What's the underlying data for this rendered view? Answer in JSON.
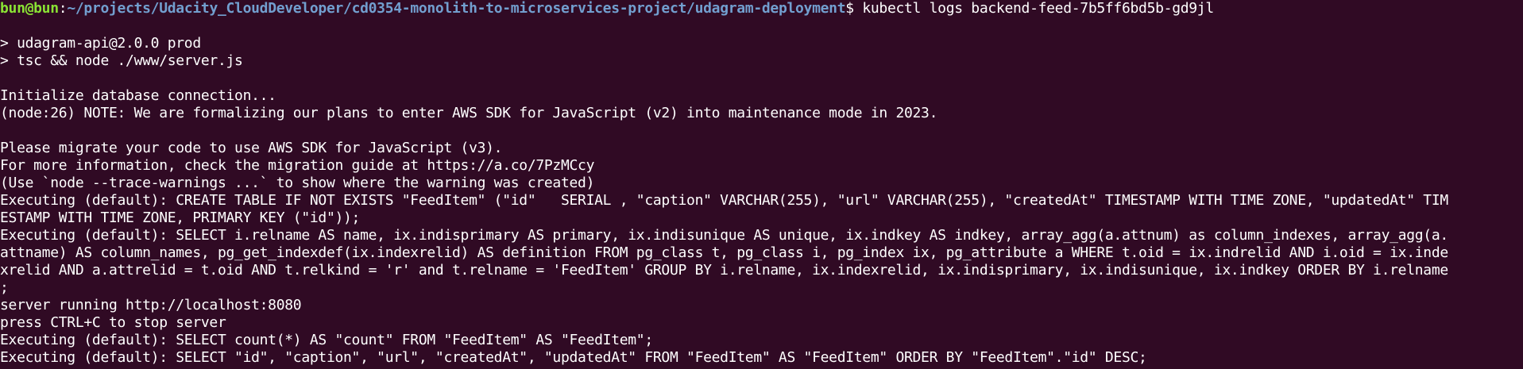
{
  "prompt": {
    "user_host": "bun@bun",
    "separator": ":",
    "path": "~/projects/Udacity_CloudDeveloper/cd0354-monolith-to-microservices-project/udagram-deployment",
    "symbol": "$ ",
    "command": "kubectl logs backend-feed-7b5ff6bd5b-gd9jl"
  },
  "output_lines": [
    "",
    "> udagram-api@2.0.0 prod",
    "> tsc && node ./www/server.js",
    "",
    "Initialize database connection...",
    "(node:26) NOTE: We are formalizing our plans to enter AWS SDK for JavaScript (v2) into maintenance mode in 2023.",
    "",
    "Please migrate your code to use AWS SDK for JavaScript (v3).",
    "For more information, check the migration guide at https://a.co/7PzMCcy",
    "(Use `node --trace-warnings ...` to show where the warning was created)",
    "Executing (default): CREATE TABLE IF NOT EXISTS \"FeedItem\" (\"id\"   SERIAL , \"caption\" VARCHAR(255), \"url\" VARCHAR(255), \"createdAt\" TIMESTAMP WITH TIME ZONE, \"updatedAt\" TIM",
    "ESTAMP WITH TIME ZONE, PRIMARY KEY (\"id\"));",
    "Executing (default): SELECT i.relname AS name, ix.indisprimary AS primary, ix.indisunique AS unique, ix.indkey AS indkey, array_agg(a.attnum) as column_indexes, array_agg(a.",
    "attname) AS column_names, pg_get_indexdef(ix.indexrelid) AS definition FROM pg_class t, pg_class i, pg_index ix, pg_attribute a WHERE t.oid = ix.indrelid AND i.oid = ix.inde",
    "xrelid AND a.attrelid = t.oid AND t.relkind = 'r' and t.relname = 'FeedItem' GROUP BY i.relname, ix.indexrelid, ix.indisprimary, ix.indisunique, ix.indkey ORDER BY i.relname",
    ";",
    "server running http://localhost:8080",
    "press CTRL+C to stop server",
    "Executing (default): SELECT count(*) AS \"count\" FROM \"FeedItem\" AS \"FeedItem\";",
    "Executing (default): SELECT \"id\", \"caption\", \"url\", \"createdAt\", \"updatedAt\" FROM \"FeedItem\" AS \"FeedItem\" ORDER BY \"FeedItem\".\"id\" DESC;"
  ],
  "colors": {
    "background": "#300a24",
    "foreground": "#ffffff",
    "user_host": "#8ae234",
    "path": "#729fcf"
  }
}
